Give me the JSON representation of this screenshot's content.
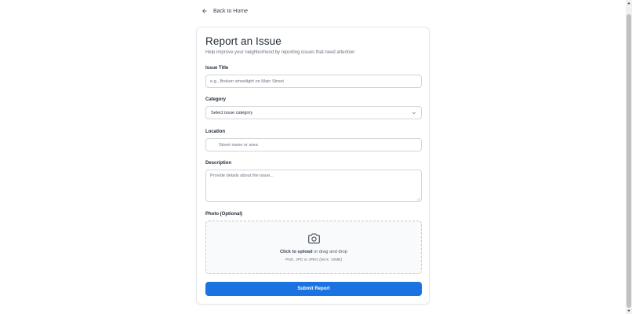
{
  "nav": {
    "back_label": "Back to Home"
  },
  "form": {
    "title": "Report an Issue",
    "subtitle": "Help improve your neighborhood by reporting issues that need attention",
    "issue_title": {
      "label": "Issue Title",
      "placeholder": "e.g., Broken streetlight on Main Street",
      "value": ""
    },
    "category": {
      "label": "Category",
      "selected": "Select issue category"
    },
    "location": {
      "label": "Location",
      "placeholder": "Street name or area",
      "value": ""
    },
    "description": {
      "label": "Description",
      "placeholder": "Provide details about the issue...",
      "value": ""
    },
    "photo": {
      "label": "Photo (Optional)",
      "upload_action": "Click to upload",
      "upload_rest": " or drag and drop",
      "hint": "PNG, JPG or JPEG (MAX. 10MB)"
    },
    "submit_label": "Submit Report"
  },
  "icons": {
    "back": "arrow-left-icon",
    "select": "chevron-down-icon",
    "location": "map-pin-icon",
    "upload": "camera-icon"
  },
  "colors": {
    "primary": "#1a73e0",
    "border": "#d1d5db",
    "muted": "#6b7280"
  }
}
